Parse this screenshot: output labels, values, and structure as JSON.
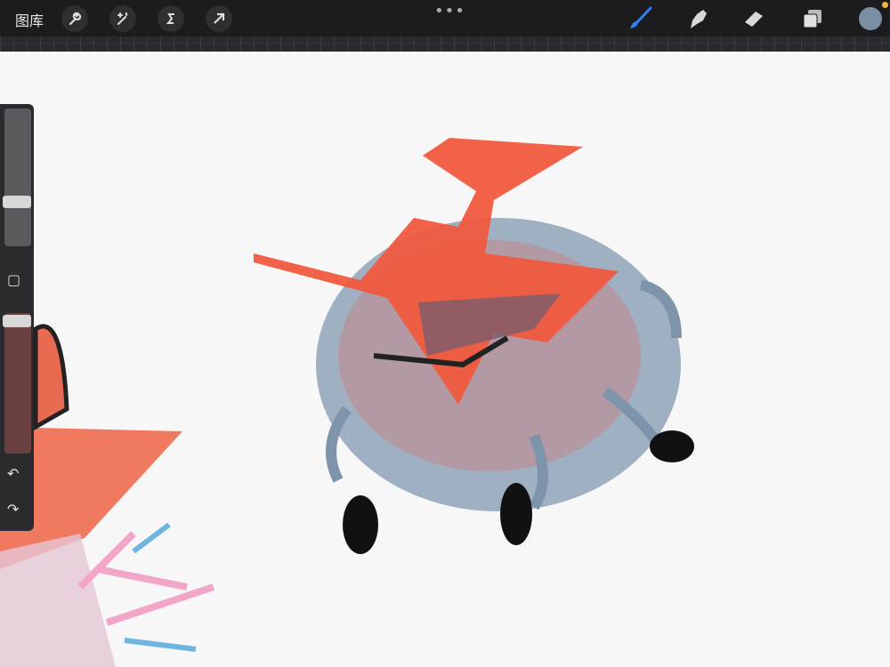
{
  "toolbar": {
    "gallery_label": "图库",
    "more": "•••",
    "left_tools": [
      "wrench-icon",
      "magic-wand-icon",
      "selection-icon",
      "move-arrow-icon"
    ],
    "right_tools": [
      "brush-icon",
      "smudge-icon",
      "eraser-icon",
      "layers-icon"
    ],
    "current_color": "#7a8ea4",
    "accent": "#2f7ff0"
  },
  "sidebar": {
    "brush_size": 0.67,
    "opacity": 0.93,
    "modify_icon": "▢",
    "undo": "↶",
    "redo": "↷"
  }
}
